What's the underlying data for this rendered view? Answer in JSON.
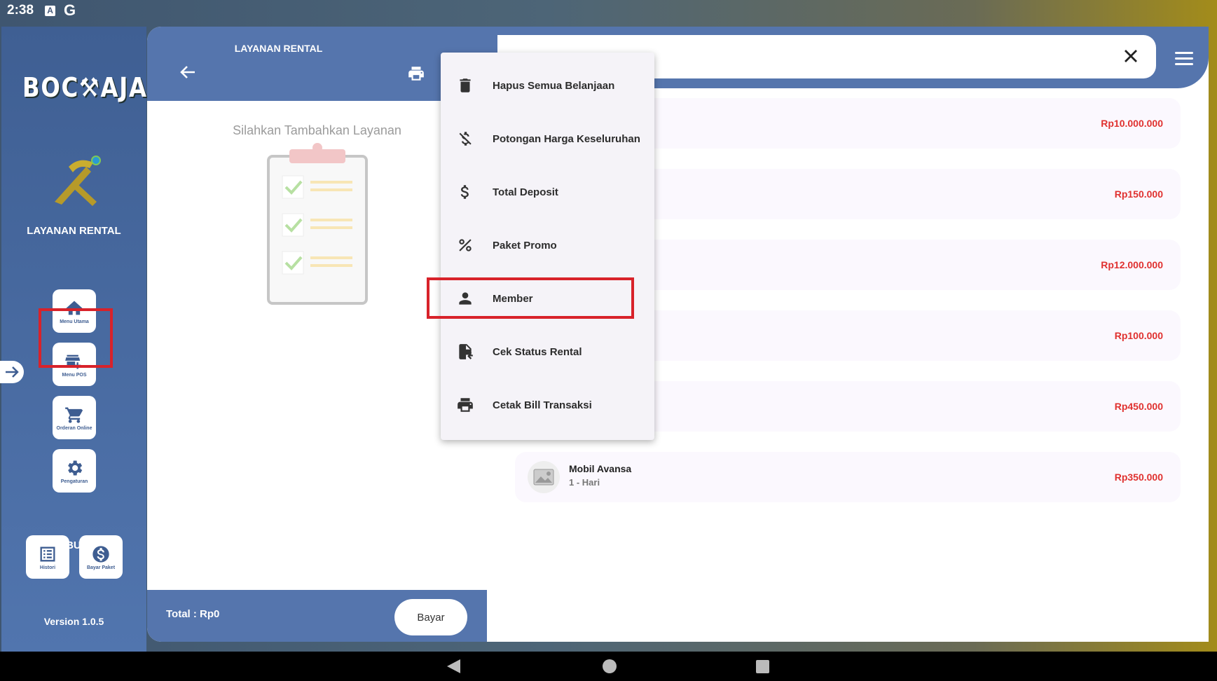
{
  "status_bar": {
    "time": "2:38",
    "icons": [
      "a-badge-icon",
      "google-icon"
    ]
  },
  "sidebar": {
    "logo": "BOC AJA",
    "title": "LAYANAN RENTAL",
    "menu": [
      {
        "label": "Menu Utama",
        "icon": "home-icon"
      },
      {
        "label": "Menu POS",
        "icon": "pos-store-icon"
      },
      {
        "label": "Orderan Online",
        "icon": "cart-icon"
      },
      {
        "label": "Pengaturan",
        "icon": "gear-icon"
      }
    ],
    "paket_title": "PAKET BUSINESS",
    "paket_buttons": [
      {
        "label": "Histori",
        "icon": "list-icon"
      },
      {
        "label": "Bayar Paket",
        "icon": "dollar-icon"
      }
    ],
    "version": "Version 1.0.5"
  },
  "center": {
    "title": "LAYANAN RENTAL",
    "empty_text": "Silahkan Tambahkan Layanan",
    "total_label": "Total :  Rp0",
    "pay_label": "Bayar"
  },
  "dropdown": {
    "items": [
      {
        "label": "Hapus Semua Belanjaan",
        "icon": "trash-icon"
      },
      {
        "label": "Potongan Harga Keseluruhan",
        "icon": "money-off-icon"
      },
      {
        "label": "Total Deposit",
        "icon": "dollar-icon"
      },
      {
        "label": "Paket Promo",
        "icon": "percent-icon"
      },
      {
        "label": "Member",
        "icon": "person-icon"
      },
      {
        "label": "Cek Status Rental",
        "icon": "file-check-icon"
      },
      {
        "label": "Cetak Bill Transaksi",
        "icon": "printer-icon"
      }
    ]
  },
  "products": [
    {
      "name": "",
      "sub": "",
      "price": "Rp10.000.000"
    },
    {
      "name": "",
      "sub": "",
      "price": "Rp150.000"
    },
    {
      "name": "",
      "sub": "",
      "price": "Rp12.000.000"
    },
    {
      "name": "",
      "sub": "",
      "price": "Rp100.000"
    },
    {
      "name": "",
      "sub": "",
      "price": "Rp450.000"
    },
    {
      "name": "Mobil Avansa",
      "sub": "1 - Hari",
      "price": "Rp350.000"
    }
  ],
  "colors": {
    "primary": "#5575ad",
    "price": "#e0312f",
    "highlight": "#d8222a"
  }
}
